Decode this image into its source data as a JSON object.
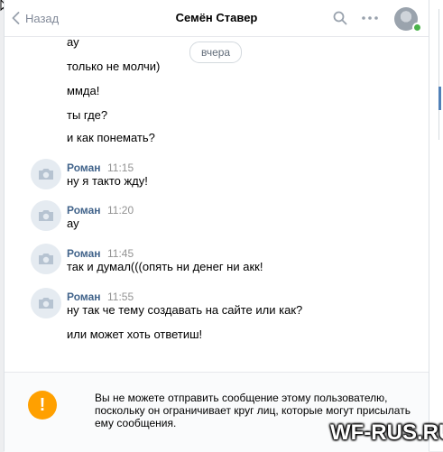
{
  "header": {
    "back_label": "Назад",
    "title": "Семён Ставер",
    "search_icon": "search-icon",
    "more_icon": "more-icon",
    "online_color": "#4bb34b"
  },
  "messages": {
    "date_separator": "вчера",
    "continued_lines": [
      "ау",
      "только не молчи)",
      "ммда!",
      "ты где?",
      "и как понемать?"
    ],
    "groups": [
      {
        "author": "Роман",
        "time": "11:15",
        "lines": [
          "ну я такто жду!"
        ]
      },
      {
        "author": "Роман",
        "time": "11:20",
        "lines": [
          "ау"
        ]
      },
      {
        "author": "Роман",
        "time": "11:45",
        "lines": [
          "так и думал(((опять ни денег ни акк!"
        ]
      },
      {
        "author": "Роман",
        "time": "11:55",
        "lines": [
          "ну так че тему создавать на сайте или как?",
          "или может хоть ответиш!"
        ]
      }
    ]
  },
  "footer": {
    "warning_icon": "!",
    "notice_lines": [
      "Вы не можете отправить сообщение этому пользователю,",
      "поскольку он ограничивает круг лиц, которые могут присылать",
      "ему сообщения."
    ],
    "warning_color": "#ffa000"
  },
  "watermark": "WF-RUS.RU",
  "colors": {
    "author": "#42648b",
    "time": "#939393",
    "accent": "#5181b8"
  }
}
